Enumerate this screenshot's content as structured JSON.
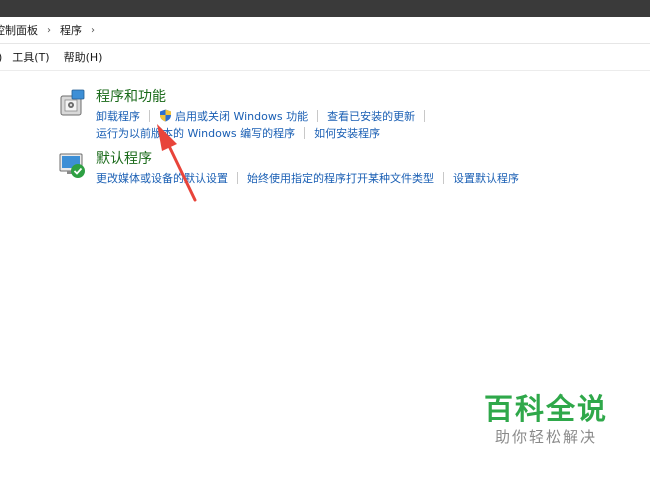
{
  "address": {
    "crumbs": [
      "控制面板",
      "程序"
    ],
    "separator": "›"
  },
  "menu": {
    "items": [
      ")",
      "工具(T)",
      "帮助(H)"
    ]
  },
  "programs": {
    "title": "程序和功能",
    "row1": [
      "卸载程序",
      "启用或关闭 Windows 功能",
      "查看已安装的更新"
    ],
    "row2": [
      "运行为以前版本的 Windows 编写的程序",
      "如何安装程序"
    ]
  },
  "defaults": {
    "title": "默认程序",
    "row1": [
      "更改媒体或设备的默认设置",
      "始终使用指定的程序打开某种文件类型",
      "设置默认程序"
    ]
  },
  "watermark": {
    "title": "百科全说",
    "subtitle": "助你轻松解决"
  },
  "colors": {
    "link": "#1a5fb4",
    "section_title": "#1a6a1a",
    "arrow": "#e8443a",
    "watermark": "#2fa84a"
  }
}
